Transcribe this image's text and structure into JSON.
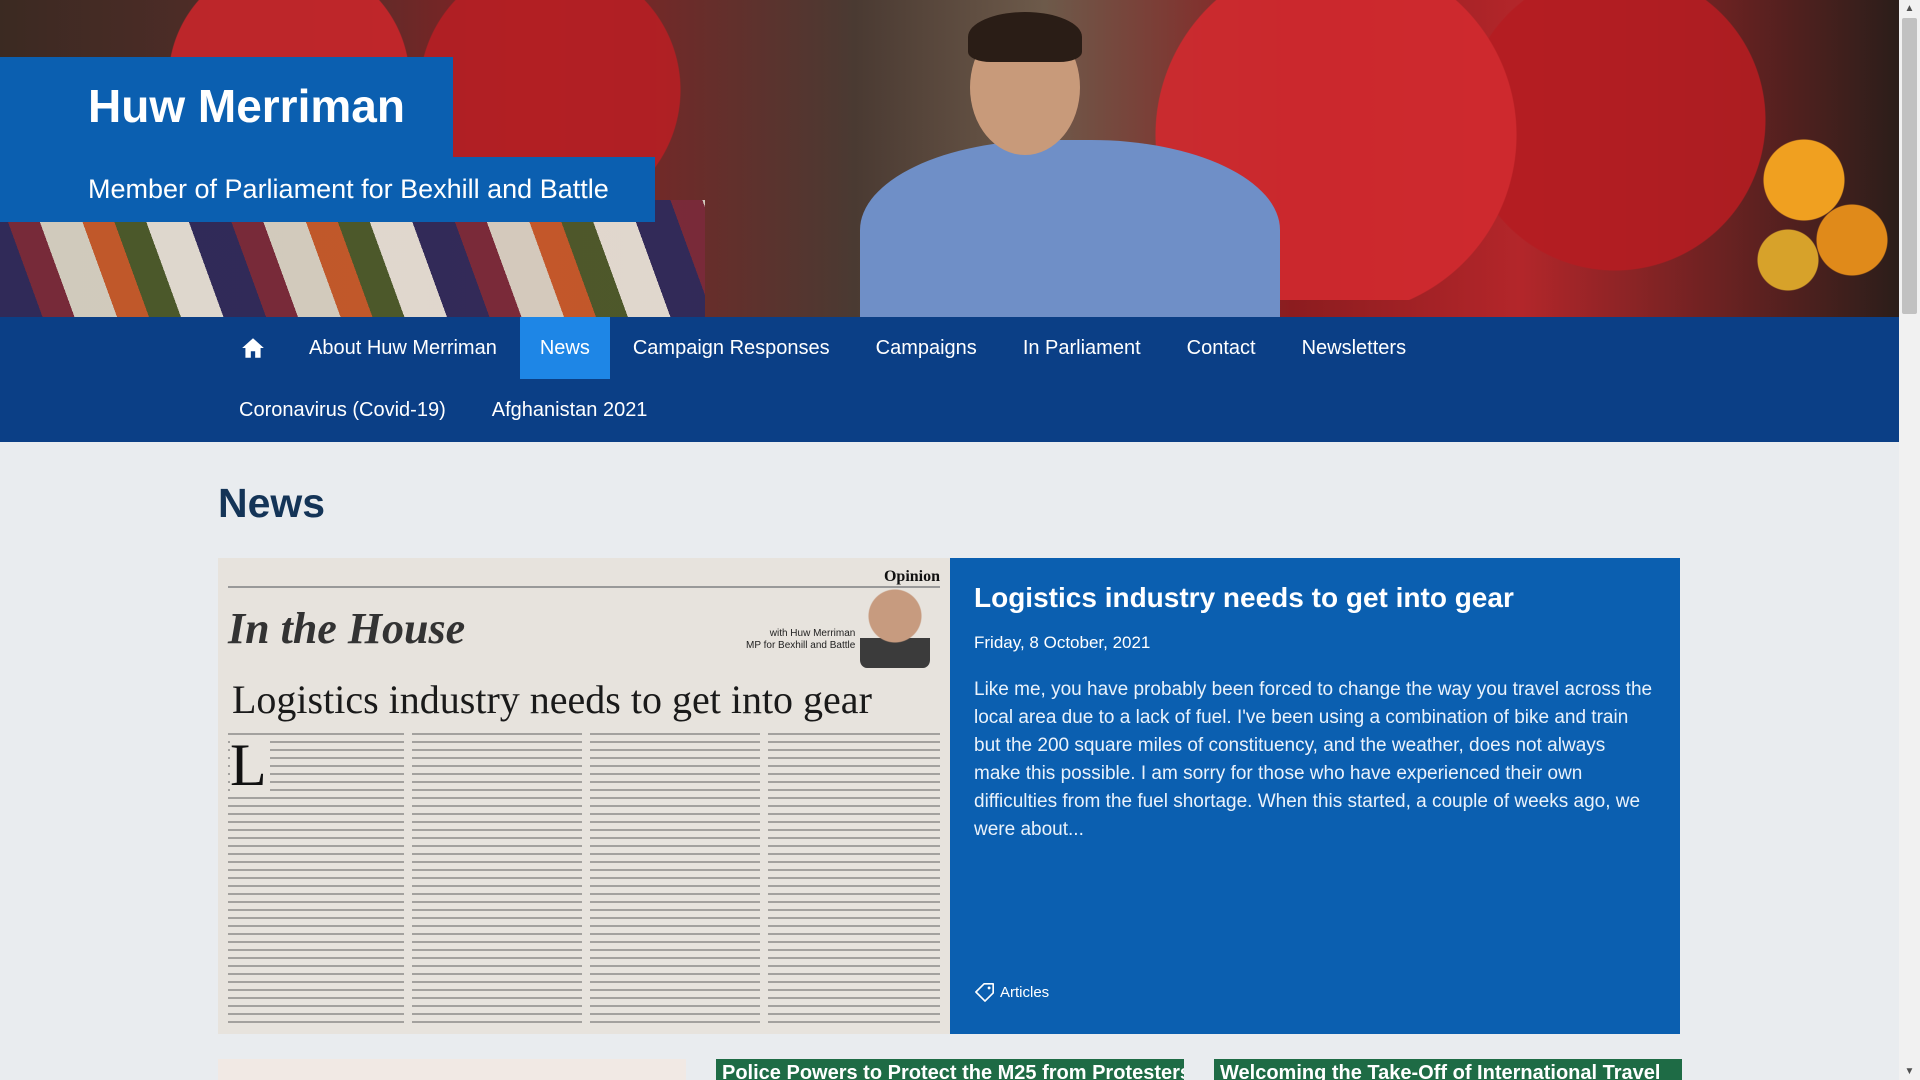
{
  "header": {
    "site_title": "Huw Merriman",
    "site_subtitle": "Member of Parliament for Bexhill and Battle"
  },
  "nav": {
    "home_icon": "home-icon",
    "row1": [
      "About Huw Merriman",
      "News",
      "Campaign Responses",
      "Campaigns",
      "In Parliament",
      "Contact",
      "Newsletters"
    ],
    "row2": [
      "Coronavirus (Covid-19)",
      "Afghanistan 2021"
    ],
    "active": "News"
  },
  "page": {
    "title": "News"
  },
  "featured": {
    "image_clip": {
      "section": "Opinion",
      "column": "In the House",
      "byline_1": "with Huw Merriman",
      "byline_2": "MP for Bexhill and Battle",
      "headline": "Logistics industry needs to get into gear",
      "dropcap": "L"
    },
    "title": "Logistics industry needs to get into gear",
    "date": "Friday, 8 October, 2021",
    "excerpt": "Like me, you have probably been forced to change the way you travel across the local area due to a lack of fuel. I've been using a combination of bike and train but the 200 square miles of constituency, and the weather, does not always make this possible. I am sorry for those who have experienced their own difficulties from the fuel shortage. When this started, a couple of weeks ago, we were about...",
    "tag": "Articles",
    "tag_icon": "tag-icon"
  },
  "cards": [
    {
      "title": ""
    },
    {
      "title": "Police Powers to Protect the M25 from Protesters"
    },
    {
      "title": "Welcoming the Take-Off of International Travel"
    }
  ],
  "colors": {
    "brand_blue": "#0b5fb0",
    "nav_blue": "#0b3f86",
    "active_tab": "#1e86e6",
    "heading": "#143457"
  }
}
